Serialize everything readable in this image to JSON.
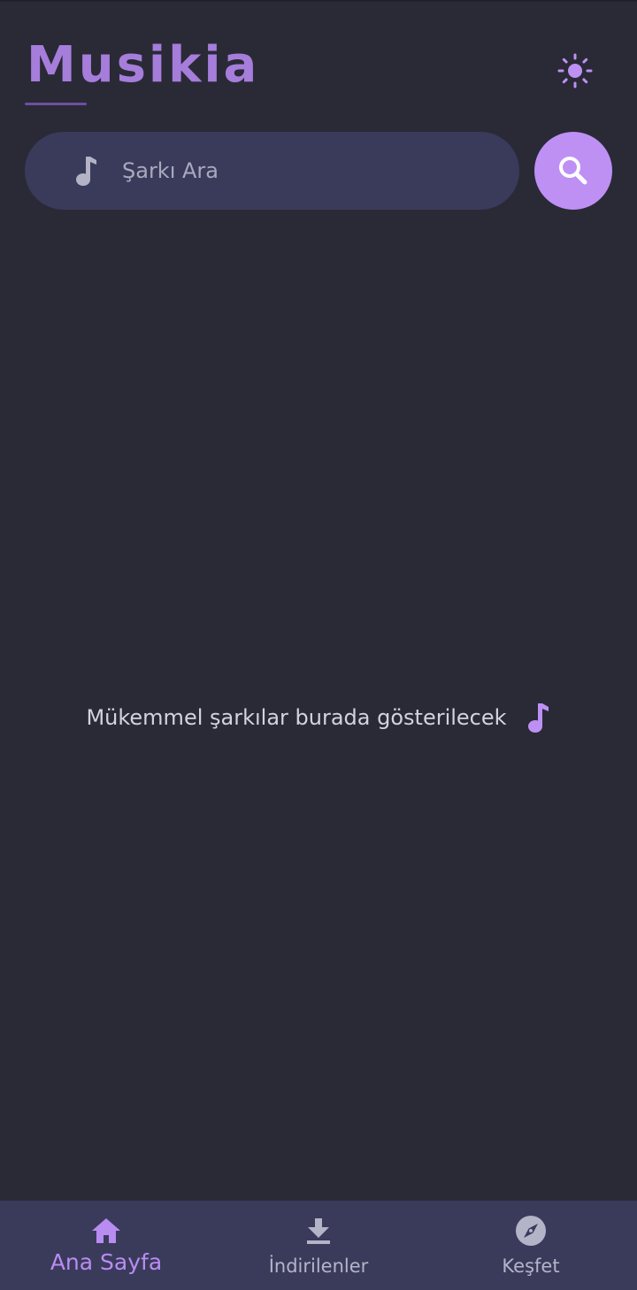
{
  "app": {
    "title": "Musikia"
  },
  "header": {
    "theme_toggle_icon": "sun-icon"
  },
  "search": {
    "placeholder": "Şarkı Ara",
    "value": "",
    "leading_icon": "music-note-icon",
    "button_icon": "search-icon"
  },
  "main": {
    "empty_message": "Mükemmel şarkılar burada gösterilecek",
    "empty_icon": "music-note-icon"
  },
  "bottom_nav": {
    "items": [
      {
        "label": "Ana Sayfa",
        "icon": "home-icon",
        "active": true
      },
      {
        "label": "İndirilenler",
        "icon": "download-icon",
        "active": false
      },
      {
        "label": "Keşfet",
        "icon": "compass-icon",
        "active": false
      }
    ]
  },
  "colors": {
    "background": "#292a36",
    "surface": "#3a3b5b",
    "accent": "#be90f4",
    "title": "#a67ddb"
  }
}
